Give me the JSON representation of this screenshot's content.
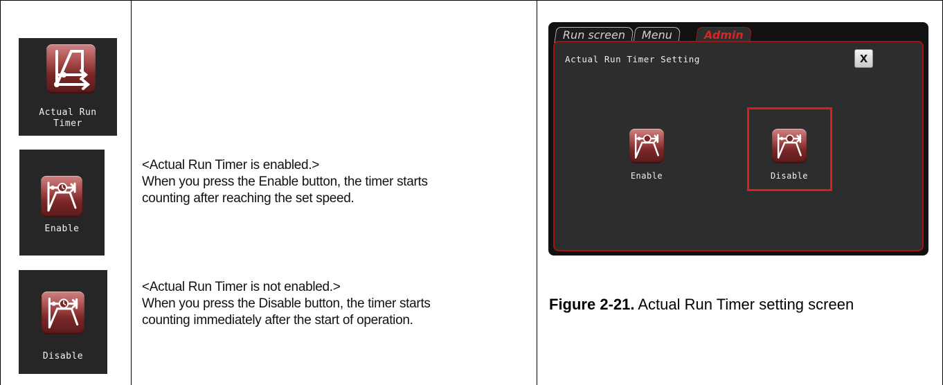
{
  "icons": {
    "actual_run_timer": "Actual Run\nTimer",
    "actual_run_timer_line1": "Actual Run",
    "actual_run_timer_line2": "Timer",
    "enable": "Enable",
    "disable": "Disable"
  },
  "descriptions": {
    "enabled": {
      "heading": "<Actual Run Timer is enabled.>",
      "line1": "When you press the Enable button, the timer starts",
      "line2": "counting after reaching the set speed."
    },
    "disabled": {
      "heading": "<Actual Run Timer is not enabled.>",
      "line1": "When you press the Disable button, the timer starts",
      "line2": "counting immediately after the start of operation."
    }
  },
  "screen": {
    "tabs": [
      "Run screen",
      "Menu",
      "Admin"
    ],
    "active_tab": "Admin",
    "title": "Actual Run Timer Setting",
    "close": "x",
    "enable_label": "Enable",
    "disable_label": "Disable",
    "highlight_color": "#e01b1b"
  },
  "caption": {
    "figure": "Figure 2-21.",
    "text": " Actual Run Timer setting screen"
  }
}
